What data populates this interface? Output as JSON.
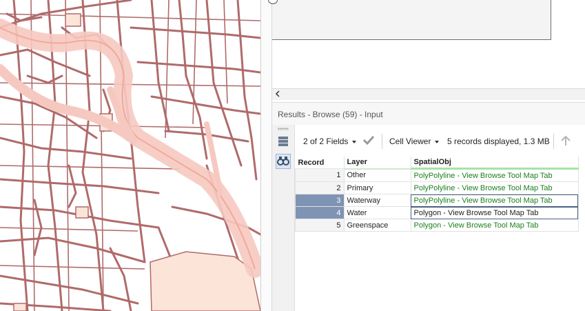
{
  "canvas": {},
  "results": {
    "title": "Results - Browse (59) - Input"
  },
  "toolbar": {
    "fields_label": "2 of 2 Fields",
    "viewer_label": "Cell Viewer",
    "status": "5 records displayed, 1.3 MB"
  },
  "table": {
    "headers": [
      "Record",
      "Layer",
      "SpatialObj"
    ],
    "rows": [
      {
        "record": "1",
        "layer": "Other",
        "spatial": "PolyPolyline - View Browse Tool Map Tab"
      },
      {
        "record": "2",
        "layer": "Primary",
        "spatial": "PolyPolyline - View Browse Tool Map Tab"
      },
      {
        "record": "3",
        "layer": "Waterway",
        "spatial": "PolyPolyline - View Browse Tool Map Tab"
      },
      {
        "record": "4",
        "layer": "Water",
        "spatial": "Polygon - View Browse Tool Map Tab"
      },
      {
        "record": "5",
        "layer": "Greenspace",
        "spatial": "Polygon - View Browse Tool Map Tab"
      }
    ]
  },
  "icons": {
    "scroll_left": "chevron-left-icon",
    "list_view": "list-icon",
    "browse_view": "binoculars-icon",
    "apply": "checkmark-icon",
    "sort_up": "arrow-up-icon"
  },
  "colors": {
    "street": "#b06a6a",
    "primary_road_fill": "#f6c9c0",
    "green_link": "#1c7e1c",
    "selected_row": "#7f93b3"
  }
}
